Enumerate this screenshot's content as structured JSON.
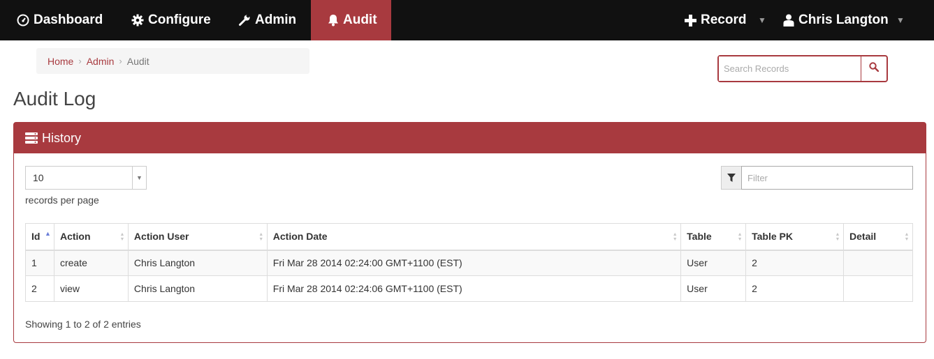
{
  "nav": {
    "dashboard": "Dashboard",
    "configure": "Configure",
    "admin": "Admin",
    "audit": "Audit",
    "record": "Record",
    "user": "Chris Langton"
  },
  "breadcrumb": {
    "home": "Home",
    "admin": "Admin",
    "current": "Audit"
  },
  "search": {
    "placeholder": "Search Records"
  },
  "page_title": "Audit Log",
  "panel": {
    "title": "History",
    "page_size": "10",
    "page_size_label": "records per page",
    "filter_placeholder": "Filter",
    "columns": [
      "Id",
      "Action",
      "Action User",
      "Action Date",
      "Table",
      "Table PK",
      "Detail"
    ],
    "rows": [
      [
        "1",
        "create",
        "Chris Langton",
        "Fri Mar 28 2014 02:24:00 GMT+1100 (EST)",
        "User",
        "2",
        ""
      ],
      [
        "2",
        "view",
        "Chris Langton",
        "Fri Mar 28 2014 02:24:06 GMT+1100 (EST)",
        "User",
        "2",
        ""
      ]
    ],
    "info": "Showing 1 to 2 of 2 entries"
  },
  "colors": {
    "navbar": "#111111",
    "accent": "#a83a3f",
    "link": "#a83a3f"
  }
}
